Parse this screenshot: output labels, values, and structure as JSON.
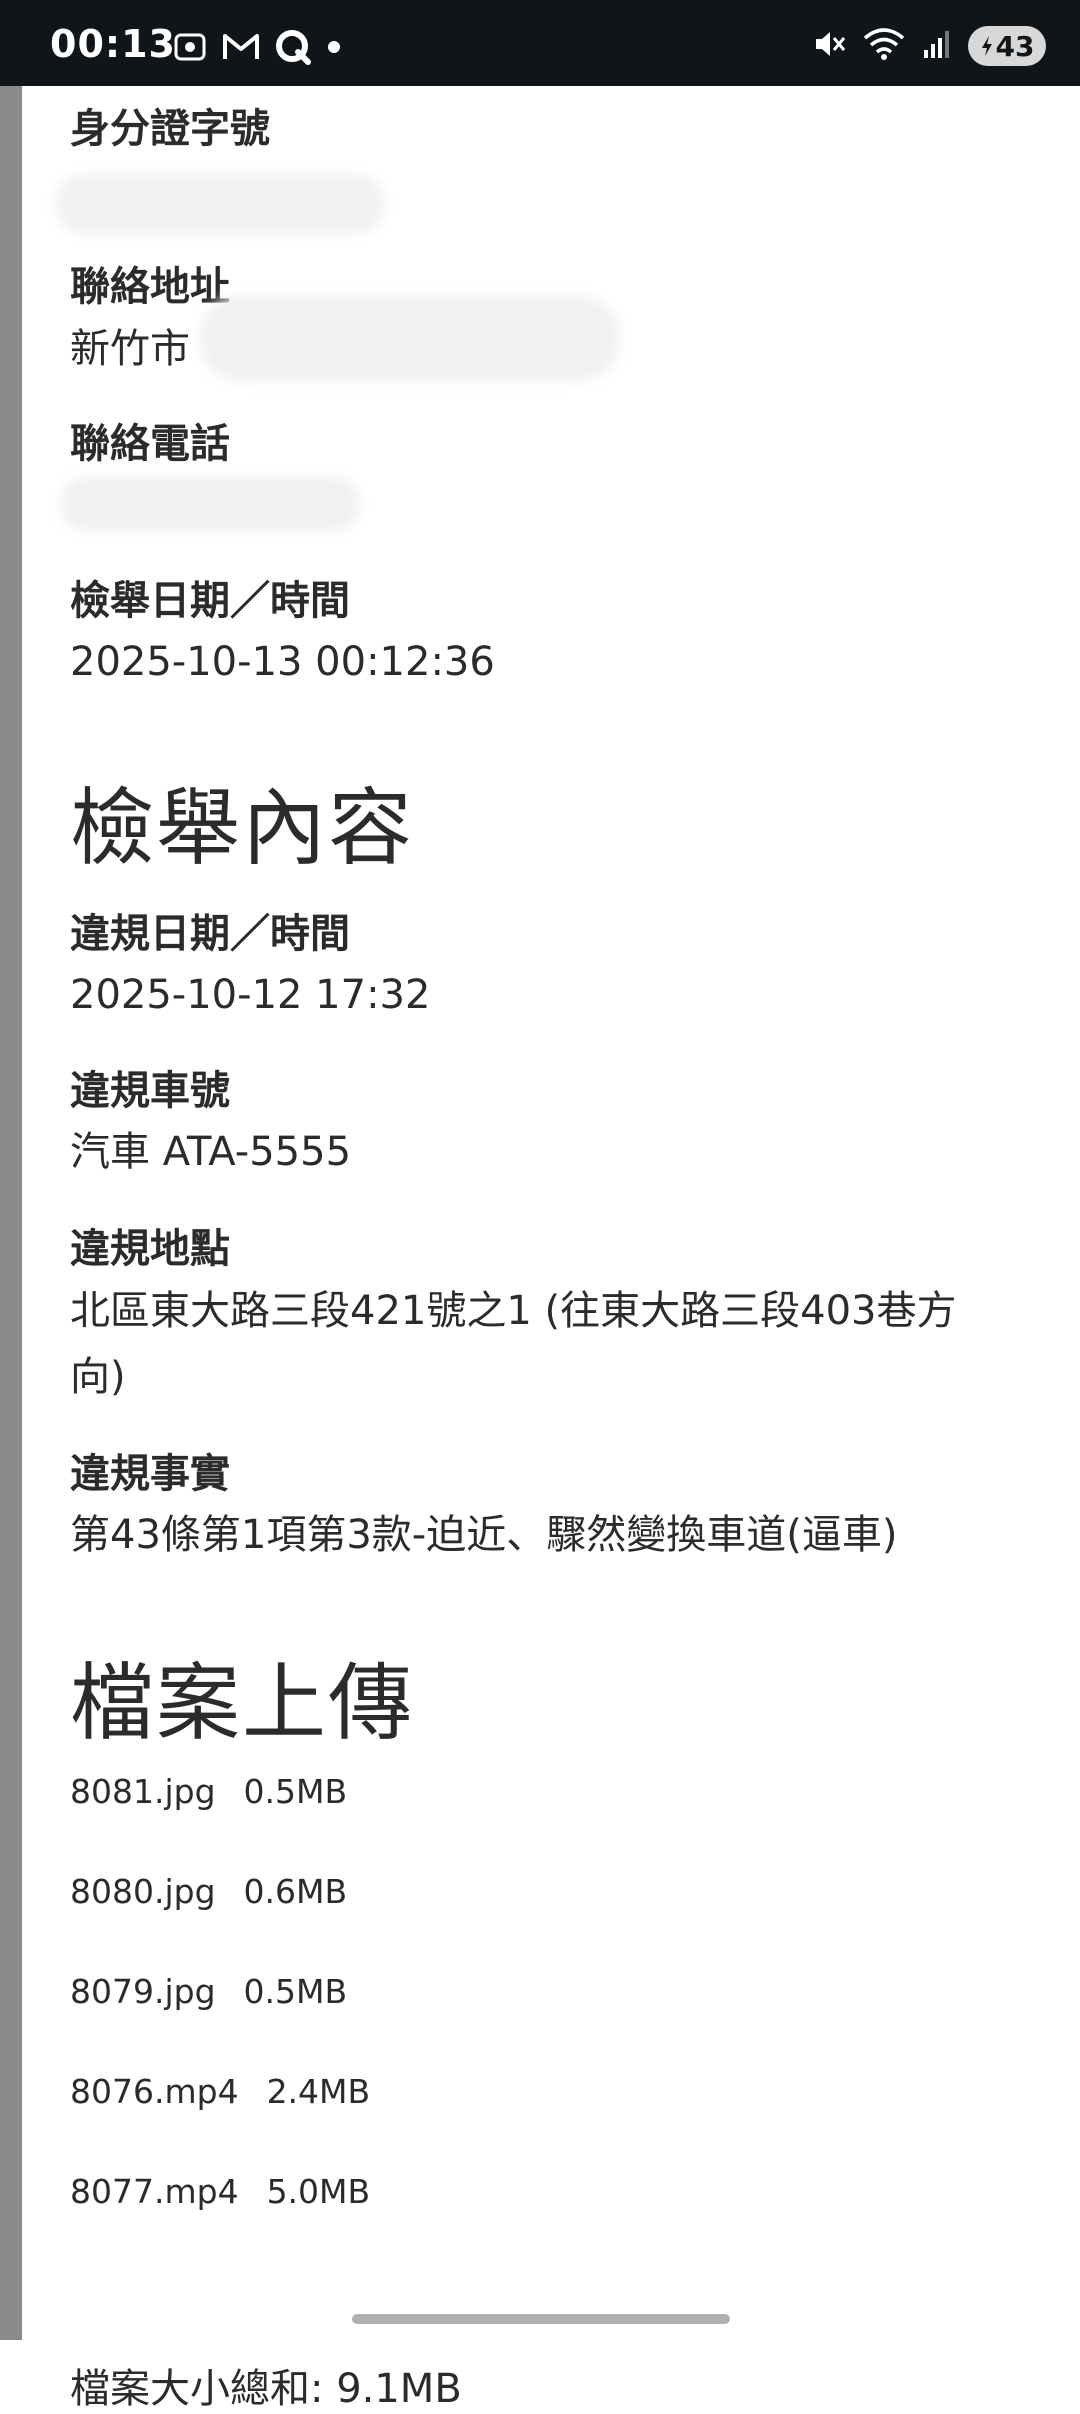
{
  "status_bar": {
    "time": "00:13",
    "battery": "43",
    "left_icons": [
      "screen-record-icon",
      "gmail-icon",
      "q-app-icon",
      "dot-icon"
    ],
    "right_icons": [
      "mute-icon",
      "wifi-icon",
      "signal-icon",
      "battery-icon"
    ]
  },
  "reporter": {
    "id_label": "身分證字號",
    "id_value": "",
    "address_label": "聯絡地址",
    "address_value": "新竹市",
    "phone_label": "聯絡電話",
    "phone_value": "",
    "report_time_label": "檢舉日期／時間",
    "report_time_value": "2025-10-13 00:12:36"
  },
  "report_content": {
    "heading": "檢舉內容",
    "violation_time_label": "違規日期／時間",
    "violation_time_value": "2025-10-12 17:32",
    "plate_label": "違規車號",
    "plate_value": "汽車 ATA-5555",
    "location_label": "違規地點",
    "location_value": "北區東大路三段421號之1 (往東大路三段403巷方向)",
    "fact_label": "違規事實",
    "fact_value": "第43條第1項第3款-迫近、驟然變換車道(逼車)"
  },
  "upload": {
    "heading": "檔案上傳",
    "files": [
      {
        "name": "8081.jpg",
        "size": "0.5MB"
      },
      {
        "name": "8080.jpg",
        "size": "0.6MB"
      },
      {
        "name": "8079.jpg",
        "size": "0.5MB"
      },
      {
        "name": "8076.mp4",
        "size": "2.4MB"
      },
      {
        "name": "8077.mp4",
        "size": "5.0MB"
      }
    ],
    "total": "檔案大小總和: 9.1MB"
  }
}
